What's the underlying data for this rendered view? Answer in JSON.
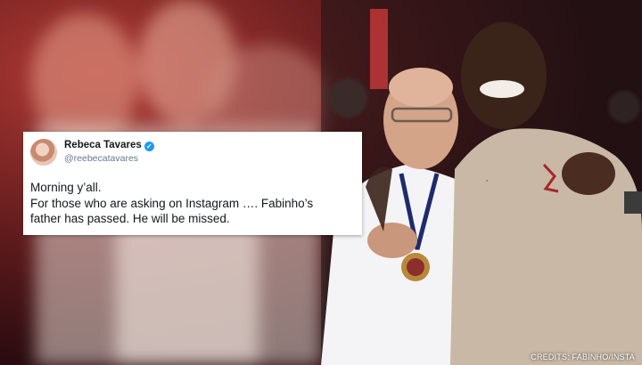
{
  "tweet": {
    "author_name": "Rebeca Tavares",
    "handle": "@reebecatavares",
    "lines": [
      "Morning y’all.",
      "For those who are asking on Instagram …. Fabinho’s",
      "father has passed. He will be missed."
    ]
  },
  "credits": "CREDITS: FABINHO/INSTA"
}
